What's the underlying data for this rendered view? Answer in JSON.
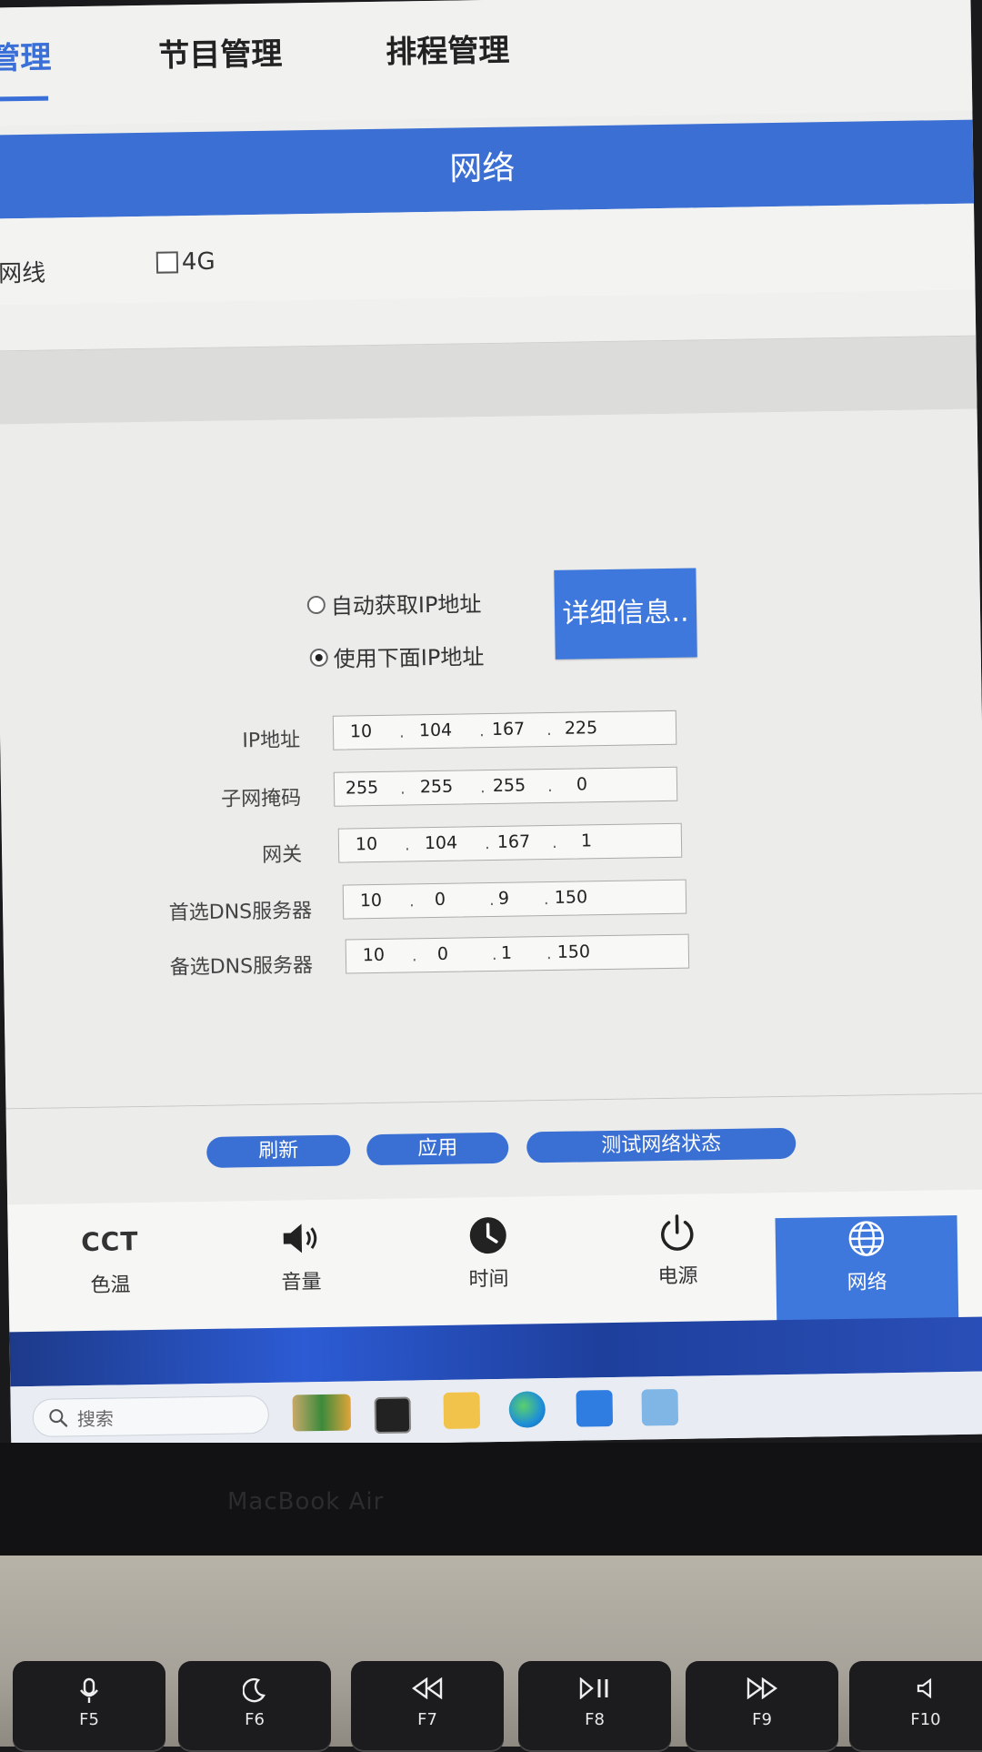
{
  "top_nav": {
    "tabs": [
      {
        "label": "管理",
        "active": true
      },
      {
        "label": "节目管理",
        "active": false
      },
      {
        "label": "排程管理",
        "active": false
      }
    ]
  },
  "section_title": "网络",
  "connection": {
    "wired_label": "网线",
    "fourg_label": "4G",
    "fourg_checked": false
  },
  "ip_mode": {
    "auto_label": "自动获取IP地址",
    "manual_label": "使用下面IP地址",
    "selected": "manual"
  },
  "detail_button": "详细信息..",
  "ip_fields": [
    {
      "label": "IP地址",
      "octets": [
        "10",
        "104",
        "167",
        "225"
      ]
    },
    {
      "label": "子网掩码",
      "octets": [
        "255",
        "255",
        "255",
        "0"
      ]
    },
    {
      "label": "网关",
      "octets": [
        "10",
        "104",
        "167",
        "1"
      ]
    },
    {
      "label": "首选DNS服务器",
      "octets": [
        "10",
        "0",
        "9",
        "150"
      ]
    },
    {
      "label": "备选DNS服务器",
      "octets": [
        "10",
        "0",
        "1",
        "150"
      ]
    }
  ],
  "actions": {
    "refresh": "刷新",
    "apply": "应用",
    "test": "测试网络状态"
  },
  "bottom_nav": [
    {
      "icon": "cct-text-icon",
      "glyph": "CCT",
      "label": "色温",
      "active": false
    },
    {
      "icon": "speaker-icon",
      "label": "音量",
      "active": false
    },
    {
      "icon": "clock-icon",
      "label": "时间",
      "active": false
    },
    {
      "icon": "power-icon",
      "label": "电源",
      "active": false
    },
    {
      "icon": "globe-icon",
      "label": "网络",
      "active": true
    }
  ],
  "taskbar": {
    "search_placeholder": "搜索",
    "apps": [
      "widgets-icon",
      "terminal-icon",
      "file-explorer-icon",
      "edge-browser-icon",
      "cloud-app-icon",
      "remote-desktop-icon"
    ]
  },
  "laptop": {
    "brand": "MacBook Air",
    "keys": [
      {
        "name": "F5",
        "glyph": "microphone-icon"
      },
      {
        "name": "F6",
        "glyph": "moon-icon"
      },
      {
        "name": "F7",
        "glyph": "rewind-icon"
      },
      {
        "name": "F8",
        "glyph": "play-pause-icon"
      },
      {
        "name": "F9",
        "glyph": "fast-forward-icon"
      },
      {
        "name": "F10",
        "glyph": "mute-icon"
      }
    ]
  },
  "colors": {
    "accent": "#3b6fd4",
    "button": "#3f78dc",
    "panel": "#ececea"
  }
}
